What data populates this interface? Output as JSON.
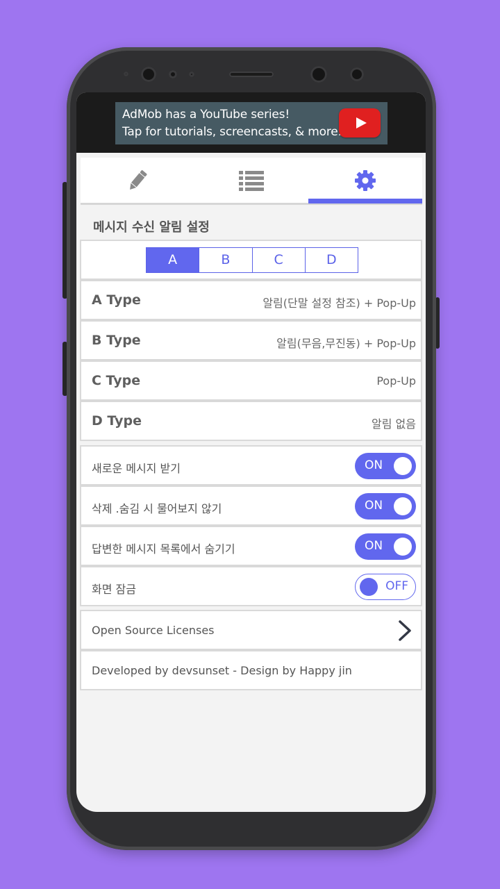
{
  "ad": {
    "line1": "AdMob has a YouTube series!",
    "line2": "Tap for tutorials, screencasts, & more."
  },
  "tabs": [
    {
      "icon": "pencil-icon"
    },
    {
      "icon": "list-icon"
    },
    {
      "icon": "gear-icon",
      "selected": true
    }
  ],
  "section_title": "메시지 수신 알림 설정",
  "segments": {
    "items": [
      "A",
      "B",
      "C",
      "D"
    ],
    "selected": "A"
  },
  "types": [
    {
      "label": "A Type",
      "value": "알림(단말 설정 참조) + Pop-Up"
    },
    {
      "label": "B Type",
      "value": "알림(무음,무진동) + Pop-Up"
    },
    {
      "label": "C Type",
      "value": "Pop-Up"
    },
    {
      "label": "D Type",
      "value": "알림 없음"
    }
  ],
  "toggles": [
    {
      "label": "새로운 메시지 받기",
      "state": "ON"
    },
    {
      "label": "삭제 .숨김 시 물어보지 않기",
      "state": "ON"
    },
    {
      "label": "답변한 메시지 목록에서 숨기기",
      "state": "ON"
    },
    {
      "label": "화면 잠금",
      "state": "OFF"
    }
  ],
  "licenses_label": "Open Source Licenses",
  "credits": "Developed  by devsunset - Design by Happy jin",
  "colors": {
    "background": "#9e75f0",
    "accent": "#6167ee",
    "ad_background": "#465a63",
    "youtube_red": "#e02020"
  }
}
